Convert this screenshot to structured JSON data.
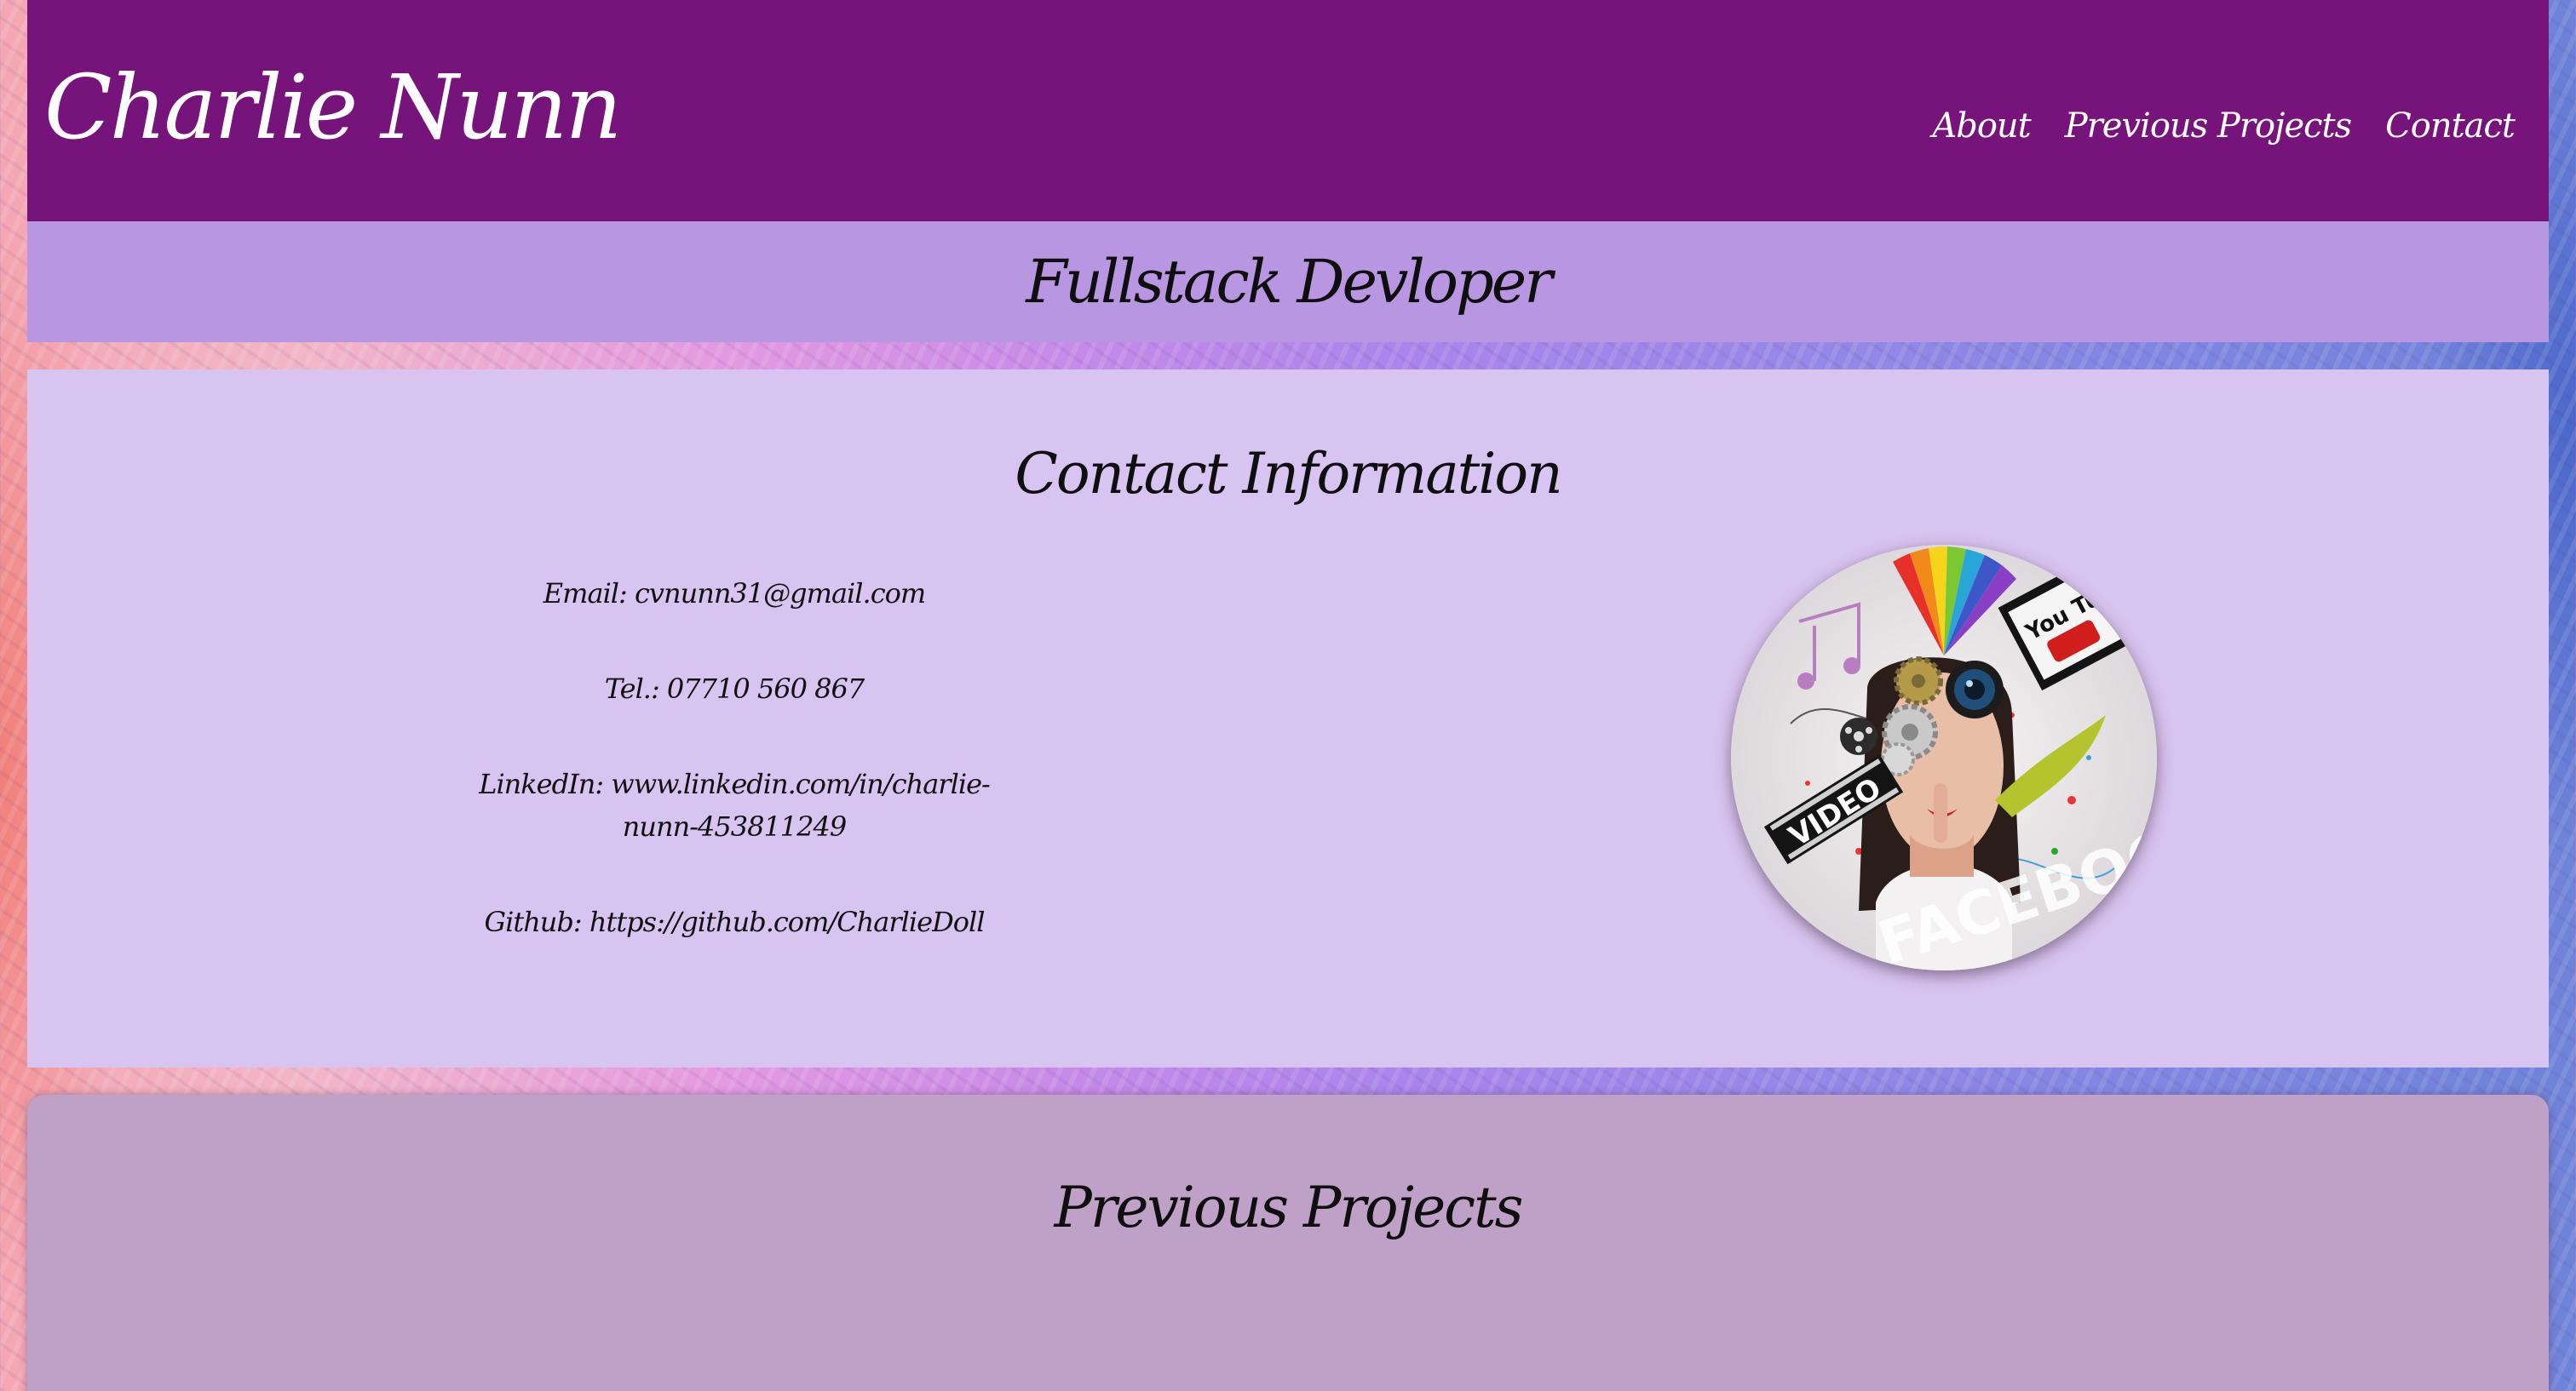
{
  "header": {
    "brand": "Charlie Nunn",
    "nav": [
      {
        "label": "About"
      },
      {
        "label": "Previous Projects"
      },
      {
        "label": "Contact"
      }
    ]
  },
  "subheader": {
    "title": "Fullstack Devloper"
  },
  "contact": {
    "title": "Contact Information",
    "email": "Email: cvnunn31@gmail.com",
    "tel": "Tel.: 07710 560 867",
    "linkedin": "LinkedIn: www.linkedin.com/in/charlie-nunn-453811249",
    "github": "Github: https://github.com/CharlieDoll",
    "image_text": {
      "youtube": "You Tube",
      "video": "VIDEO",
      "facebook": "FACEBOOK"
    }
  },
  "projects": {
    "title": "Previous Projects"
  },
  "colors": {
    "header_bg": "#76147c",
    "subheader_bg": "#b896e2",
    "contact_bg": "#d8c4f0",
    "projects_bg": "#bfa0c7"
  }
}
